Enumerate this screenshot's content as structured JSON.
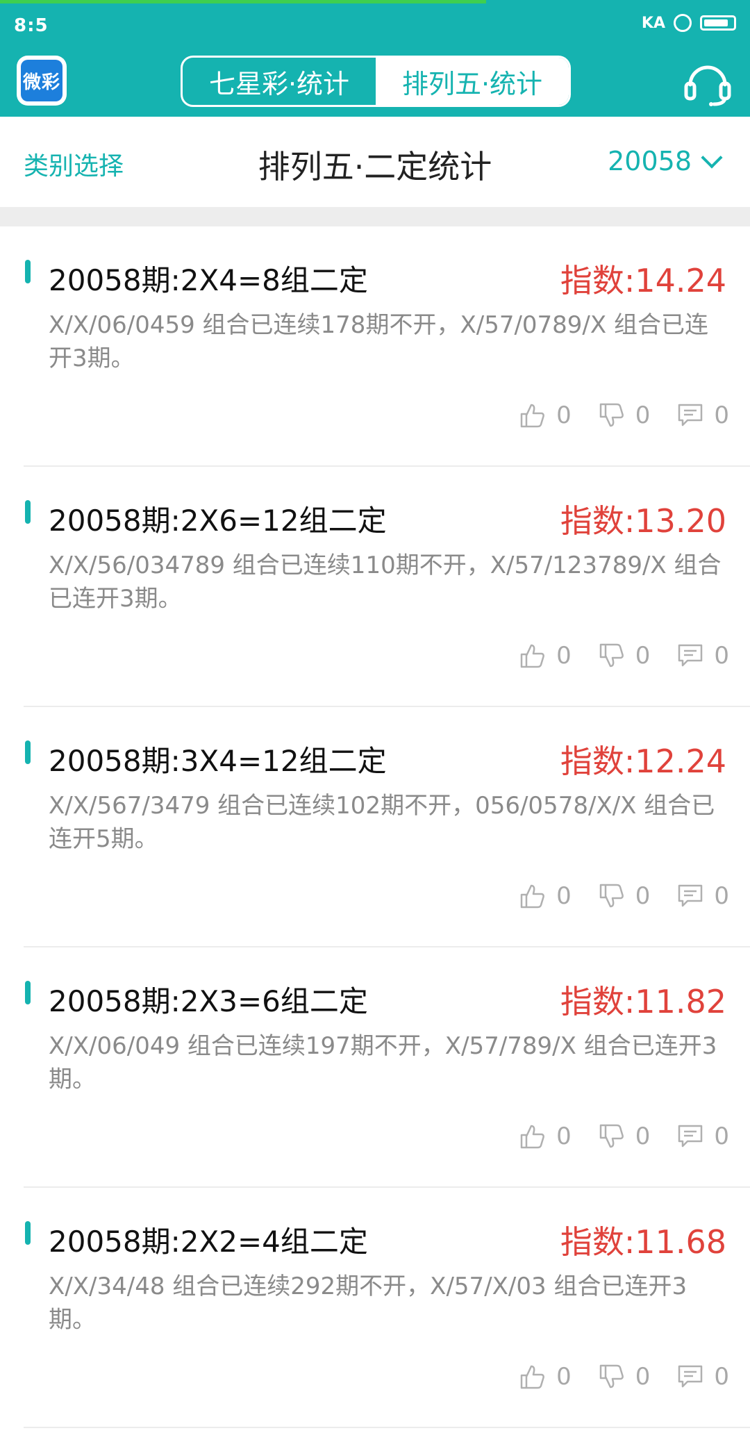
{
  "status_bar": {
    "time": "8:5",
    "network": "KA"
  },
  "app": {
    "logo_text": "微彩"
  },
  "tabs": [
    {
      "label": "七星彩·统计",
      "active": false
    },
    {
      "label": "排列五·统计",
      "active": true
    }
  ],
  "subheader": {
    "category_label": "类别选择",
    "title": "排列五·二定统计",
    "period": "20058"
  },
  "colors": {
    "brand": "#15b3b0",
    "index": "#e0423b",
    "muted": "#8a8a8a"
  },
  "items": [
    {
      "title": "20058期:2X4=8组二定",
      "index": "指数:14.24",
      "desc": "X/X/06/0459 组合已连续178期不开，X/57/0789/X 组合已连开3期。",
      "likes": "0",
      "dislikes": "0",
      "comments": "0"
    },
    {
      "title": "20058期:2X6=12组二定",
      "index": "指数:13.20",
      "desc": "X/X/56/034789 组合已连续110期不开，X/57/123789/X 组合已连开3期。",
      "likes": "0",
      "dislikes": "0",
      "comments": "0"
    },
    {
      "title": "20058期:3X4=12组二定",
      "index": "指数:12.24",
      "desc": "X/X/567/3479 组合已连续102期不开，056/0578/X/X 组合已连开5期。",
      "likes": "0",
      "dislikes": "0",
      "comments": "0"
    },
    {
      "title": "20058期:2X3=6组二定",
      "index": "指数:11.82",
      "desc": "X/X/06/049 组合已连续197期不开，X/57/789/X 组合已连开3期。",
      "likes": "0",
      "dislikes": "0",
      "comments": "0"
    },
    {
      "title": "20058期:2X2=4组二定",
      "index": "指数:11.68",
      "desc": "X/X/34/48 组合已连续292期不开，X/57/X/03 组合已连开3期。",
      "likes": "0",
      "dislikes": "0",
      "comments": "0"
    }
  ]
}
